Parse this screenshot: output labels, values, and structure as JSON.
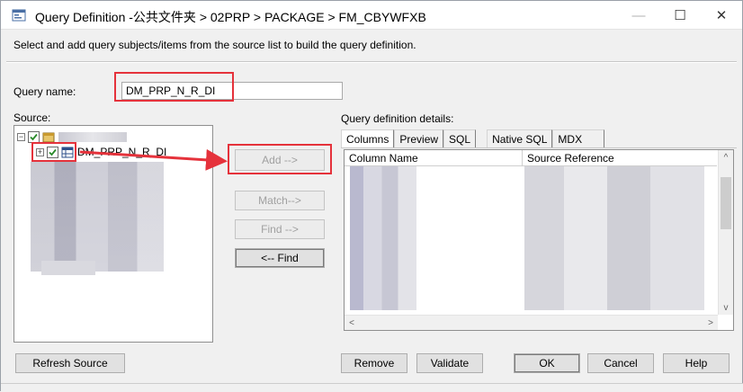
{
  "window": {
    "title": "Query Definition -公共文件夹 > 02PRP > PACKAGE > FM_CBYWFXB",
    "minimize_glyph": "—",
    "maximize_glyph": "☐",
    "close_glyph": "✕"
  },
  "instructions": "Select and add query subjects/items from the source list to build the query definition.",
  "query_name": {
    "label": "Query name:",
    "value": "DM_PRP_N_R_DI"
  },
  "source": {
    "label": "Source:",
    "tree": [
      {
        "label": "",
        "expander": "−",
        "icon": "package-icon"
      },
      {
        "label": "DM_PRP_N_R_DI",
        "expander": "+",
        "icon": "query-subject-icon"
      }
    ]
  },
  "middle_buttons": {
    "add": "Add -->",
    "match": "Match-->",
    "find": "Find -->",
    "back_find": "<-- Find"
  },
  "details": {
    "label": "Query definition details:",
    "tabs": [
      "Columns",
      "Preview",
      "SQL",
      "Native SQL",
      "MDX"
    ],
    "columns": [
      "Column Name",
      "Source Reference"
    ]
  },
  "bottom_buttons": {
    "refresh": "Refresh Source",
    "remove": "Remove",
    "validate": "Validate",
    "ok": "OK",
    "cancel": "Cancel",
    "help": "Help"
  },
  "colors": {
    "annotation_red": "#e5323b",
    "checkbox_green": "#2a8a2a"
  }
}
